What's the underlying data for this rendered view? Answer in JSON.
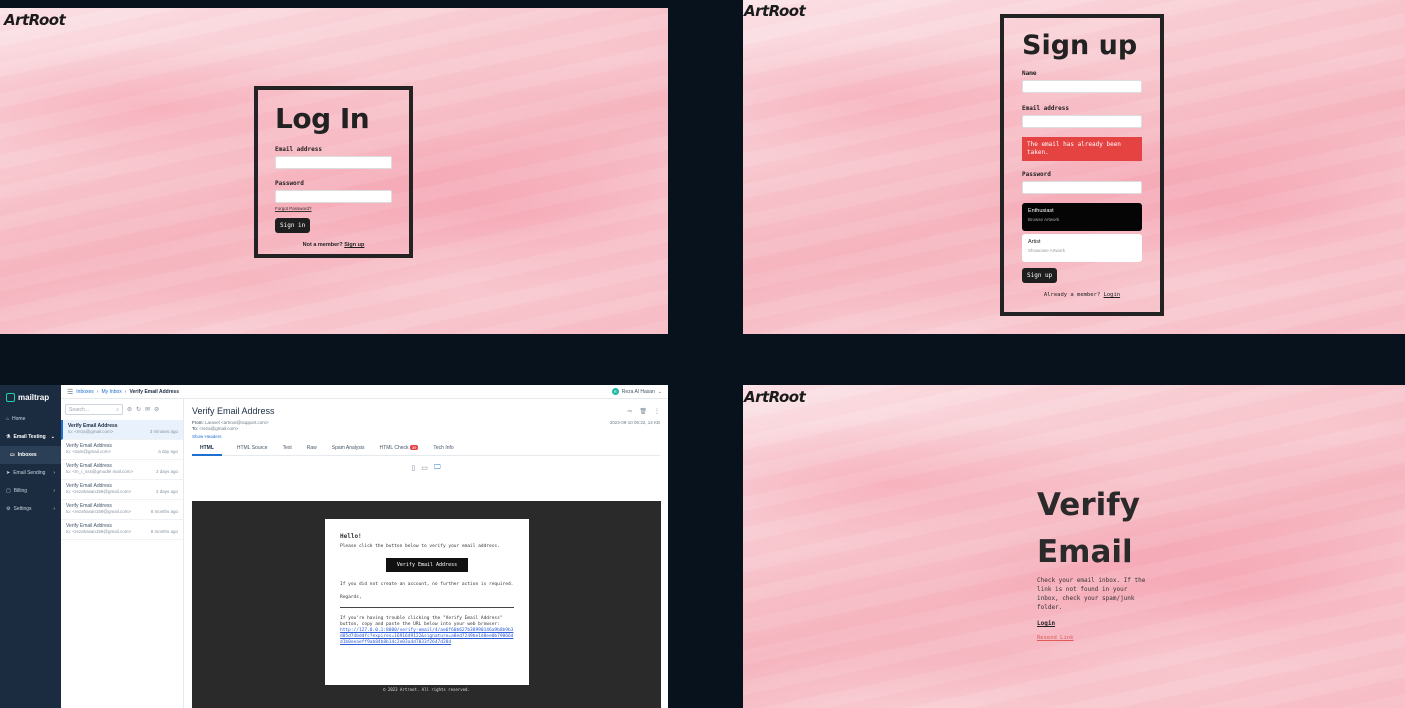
{
  "brand": {
    "logo": "ArtRoot"
  },
  "login": {
    "title": "Log In",
    "email_label": "Email address",
    "password_label": "Password",
    "forgot": "Forgot Password?",
    "submit": "Sign in",
    "footer_prefix": "Not a member?",
    "footer_link": "Sign up"
  },
  "signup": {
    "title": "Sign up",
    "name_label": "Name",
    "email_label": "Email address",
    "error": "The email has already been taken.",
    "password_label": "Password",
    "roles": [
      {
        "title": "Enthusiast",
        "subtitle": "Browse Artwork"
      },
      {
        "title": "Artist",
        "subtitle": "Showcase Artwork"
      }
    ],
    "submit": "Sign up",
    "footer_prefix": "Already a member?",
    "footer_link": "Login"
  },
  "mailtrap": {
    "brand": "mailtrap",
    "nav": {
      "home": "Home",
      "email_testing": "Email Testing",
      "inboxes": "Inboxes",
      "email_sending": "Email Sending",
      "billing": "Billing",
      "settings": "Settings"
    },
    "breadcrumb": {
      "inboxes": "Inboxes",
      "my_inbox": "My Inbox",
      "current": "Verify Email Address"
    },
    "user": {
      "initial": "R",
      "name": "Reza Al Hasan"
    },
    "search_placeholder": "Search...",
    "messages": [
      {
        "subject": "Verify Email Address",
        "to": "to: <reza@gmail.com>",
        "time": "3 minutes ago"
      },
      {
        "subject": "Verify Email Address",
        "to": "to: <sam@gmail.com>",
        "time": "a day ago"
      },
      {
        "subject": "Verify Email Address",
        "to": "to: <m_r_sss@gmudel mail.com>",
        "time": "2 days ago"
      },
      {
        "subject": "Verify Email Address",
        "to": "to: <rezahasan159@gmail.com>",
        "time": "2 days ago"
      },
      {
        "subject": "Verify Email Address",
        "to": "to: <rezahasan159@gmail.com>",
        "time": "8 months ago"
      },
      {
        "subject": "Verify Email Address",
        "to": "to: <rezahasan159@gmail.com>",
        "time": "8 months ago"
      }
    ],
    "message": {
      "title": "Verify Email Address",
      "from_label": "From:",
      "from": "Laravel <artroot@support.com>",
      "to_label": "To:",
      "to": "<reza@gmail.com>",
      "date": "2023-09-10 05:32, 14 KB",
      "show_headers": "Show Headers"
    },
    "tabs": {
      "html": "HTML",
      "html_source": "HTML Source",
      "text": "Text",
      "raw": "Raw",
      "spam": "Spam Analysis",
      "html_check": "HTML Check",
      "html_check_badge": "39",
      "tech": "Tech Info"
    },
    "email": {
      "hello": "Hello!",
      "intro": "Please click the button below to verify your email address.",
      "button": "Verify Email Address",
      "note": "If you did not create an account, no further action is required.",
      "regards": "Regards,",
      "trouble": "If you're having trouble clicking the \"Verify Email Address\" button, copy and paste the URL below into your web browser:",
      "url": "http://127.0.0.1:8000/verify-email/4/ae6f60b627b38990146a9b8b9b3d85d74bddfc?expires=1691649122&signature=a8ed7249be1d8ee0b79066dd1b0eeaeff9ab84b8b14c2e03a4d7033f2647d20d",
      "copyright": "© 2023 Artroot. All rights reserved."
    }
  },
  "verify": {
    "title_line1": "Verify",
    "title_line2": "Email",
    "text": "Check your email inbox. If the link is not found in your inbox, check your spam/junk folder.",
    "login": "Login",
    "resend": "Resend Link"
  }
}
